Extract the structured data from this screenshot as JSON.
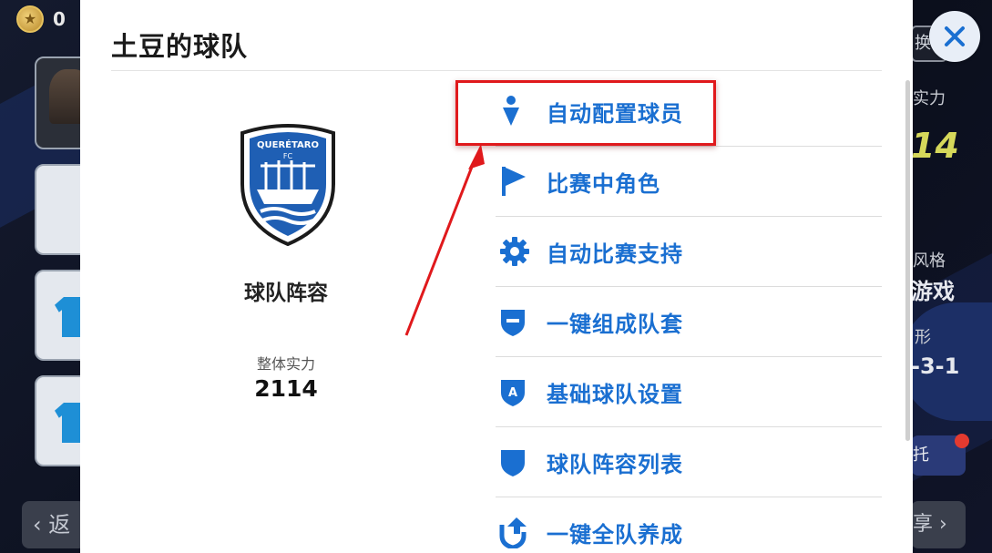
{
  "background": {
    "coin_count": "0",
    "back_button_label": "返",
    "right_edge": {
      "top_button_label": "换",
      "strength_label": "实力",
      "strength_value": "14",
      "style_label": "风格",
      "style_value": "游戏",
      "formation_label": "形",
      "formation_value": "-3-1",
      "trust_label": "托",
      "share_label": "享"
    }
  },
  "modal": {
    "title": "土豆的球队",
    "team": {
      "section_label": "球队阵容",
      "strength_label": "整体实力",
      "strength_value": "2114",
      "crest_text_top": "QUERÉTARO",
      "crest_text_bottom": "FC"
    },
    "menu": [
      {
        "label": "自动配置球员",
        "icon": "person-pin-icon"
      },
      {
        "label": "比赛中角色",
        "icon": "flag-icon"
      },
      {
        "label": "自动比赛支持",
        "icon": "gear-icon"
      },
      {
        "label": "一键组成队套",
        "icon": "shield-minus-icon"
      },
      {
        "label": "基础球队设置",
        "icon": "shield-a-icon"
      },
      {
        "label": "球队阵容列表",
        "icon": "shield-icon"
      },
      {
        "label": "一键全队养成",
        "icon": "upgrade-arrow-icon"
      }
    ]
  },
  "colors": {
    "accent": "#1a6fd1",
    "annotation": "#e0191c"
  }
}
